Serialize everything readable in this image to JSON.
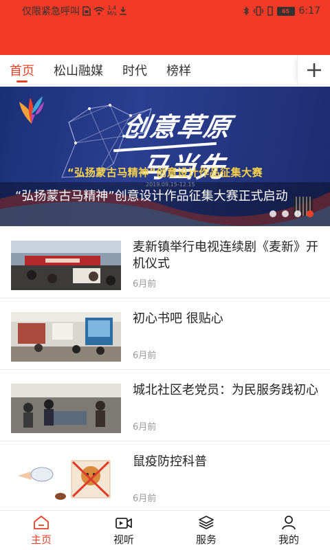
{
  "status_bar": {
    "carrier_text": "仅限紧急呼叫",
    "network_speed_value": "1.4",
    "network_speed_unit": "M/s",
    "battery_level": "65",
    "time": "6:17"
  },
  "colors": {
    "brand_red": "#f23a26",
    "accent": "#e8422a"
  },
  "tabs": [
    {
      "label": "首页",
      "active": true
    },
    {
      "label": "松山融媒",
      "active": false
    },
    {
      "label": "时代",
      "active": false
    },
    {
      "label": "榜样",
      "active": false
    }
  ],
  "add_tab_icon": "plus-icon",
  "banner": {
    "headline_line1": "创意草原",
    "headline_line2": "马当先",
    "subtitle": "“弘扬蒙古马精神”创意设计作品征集大赛",
    "date_range": "2019.09.15-12.15",
    "caption": "“弘扬蒙古马精神”创意设计作品征集大赛正式启动",
    "slide_count": 4,
    "active_slide": 4
  },
  "news": [
    {
      "title": "麦新镇举行电视连续剧《麦新》开机仪式",
      "time": "6月前"
    },
    {
      "title": "初心书吧 很贴心",
      "time": "6月前"
    },
    {
      "title": "城北社区老党员：为民服务践初心",
      "time": "6月前"
    },
    {
      "title": "鼠疫防控科普",
      "time": "6月前"
    }
  ],
  "bottom_nav": [
    {
      "label": "主页",
      "icon": "home-icon",
      "active": true
    },
    {
      "label": "视听",
      "icon": "video-icon",
      "active": false
    },
    {
      "label": "服务",
      "icon": "layers-icon",
      "active": false
    },
    {
      "label": "我的",
      "icon": "user-icon",
      "active": false
    }
  ]
}
